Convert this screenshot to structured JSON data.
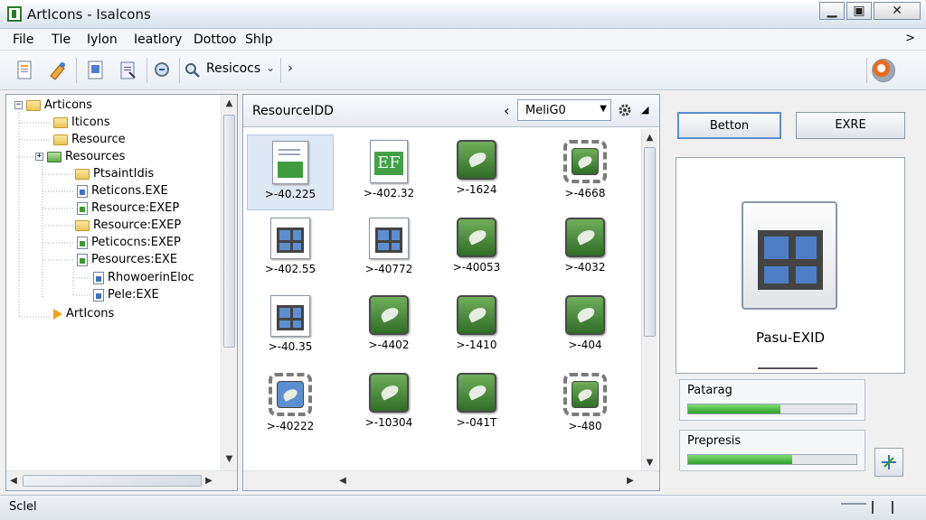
{
  "window": {
    "title": "ArtIcons - Isalcons",
    "controls": {
      "minimize": "▁",
      "maximize": "▣",
      "close": "✕"
    }
  },
  "menu": {
    "items": [
      "File",
      "Tle",
      "Iylon",
      "Ieatlory",
      "Dottoo",
      "Shlp"
    ],
    "overflow": ">"
  },
  "toolbar": {
    "icons": [
      "new-document-icon",
      "paint-icon",
      "edit-icon",
      "clipboard-icon",
      "zoom-icon",
      "search-icon",
      "globe-icon"
    ],
    "search_label": "Resicocs",
    "dropdown_arrow": "⌄",
    "next_arrow": "›"
  },
  "tree": {
    "items": [
      {
        "label": "Articons",
        "expander": "−",
        "icon": "folder"
      },
      {
        "label": "Iticons",
        "icon": "folder"
      },
      {
        "label": "Resource",
        "icon": "folder"
      },
      {
        "label": "Resources",
        "expander": "+",
        "icon": "folder-green"
      },
      {
        "label": "PtsaintIdis",
        "icon": "folder"
      },
      {
        "label": "Reticons.EXE",
        "icon": "file-blue"
      },
      {
        "label": "Resource:EXEP",
        "icon": "file-green"
      },
      {
        "label": "Resource:EXEP",
        "icon": "folder"
      },
      {
        "label": "Peticocns:EXEP",
        "icon": "file-green"
      },
      {
        "label": "Pesources:EXE",
        "icon": "file-green"
      },
      {
        "label": "RhowoerinEloc",
        "icon": "file-blue"
      },
      {
        "label": "Pele:EXE",
        "icon": "file-blue"
      },
      {
        "label": "ArtIcons",
        "icon": "arrow"
      }
    ]
  },
  "middle": {
    "title": "ResourceIDD",
    "back_arrow": "‹",
    "dropdown_value": "MeliG0",
    "gear_icon": "gear-icon",
    "pin": "◢",
    "grid": [
      {
        "caption": ">-40.225",
        "icon": "doc"
      },
      {
        "caption": ">-402.32",
        "icon": "ef"
      },
      {
        "caption": ">-1624",
        "icon": "green"
      },
      {
        "caption": ">-4668",
        "icon": "gear-green"
      },
      {
        "caption": ">-402.55",
        "icon": "window"
      },
      {
        "caption": ">-40772",
        "icon": "window"
      },
      {
        "caption": ">-40053",
        "icon": "green"
      },
      {
        "caption": ">-4032",
        "icon": "green"
      },
      {
        "caption": ">-40.35",
        "icon": "window"
      },
      {
        "caption": ">-4402",
        "icon": "green"
      },
      {
        "caption": ">-1410",
        "icon": "green"
      },
      {
        "caption": ">-404",
        "icon": "green"
      },
      {
        "caption": ">-40222",
        "icon": "gear-window"
      },
      {
        "caption": ">-10304",
        "icon": "green"
      },
      {
        "caption": ">-041T",
        "icon": "green"
      },
      {
        "caption": ">-480",
        "icon": "gear-green"
      }
    ]
  },
  "right": {
    "button1": "Betton",
    "button2": "EXRE",
    "preview_caption": "Pasu-EXID",
    "progress1": {
      "label": "Patarag",
      "fraction": 0.55
    },
    "progress2": {
      "label": "Prepresis",
      "fraction": 0.62
    }
  },
  "status": {
    "text": "Sclel"
  },
  "colors": {
    "accent": "#5c8fcf",
    "progress": "#2e9f2a",
    "panel_border": "#8ea3bd"
  }
}
